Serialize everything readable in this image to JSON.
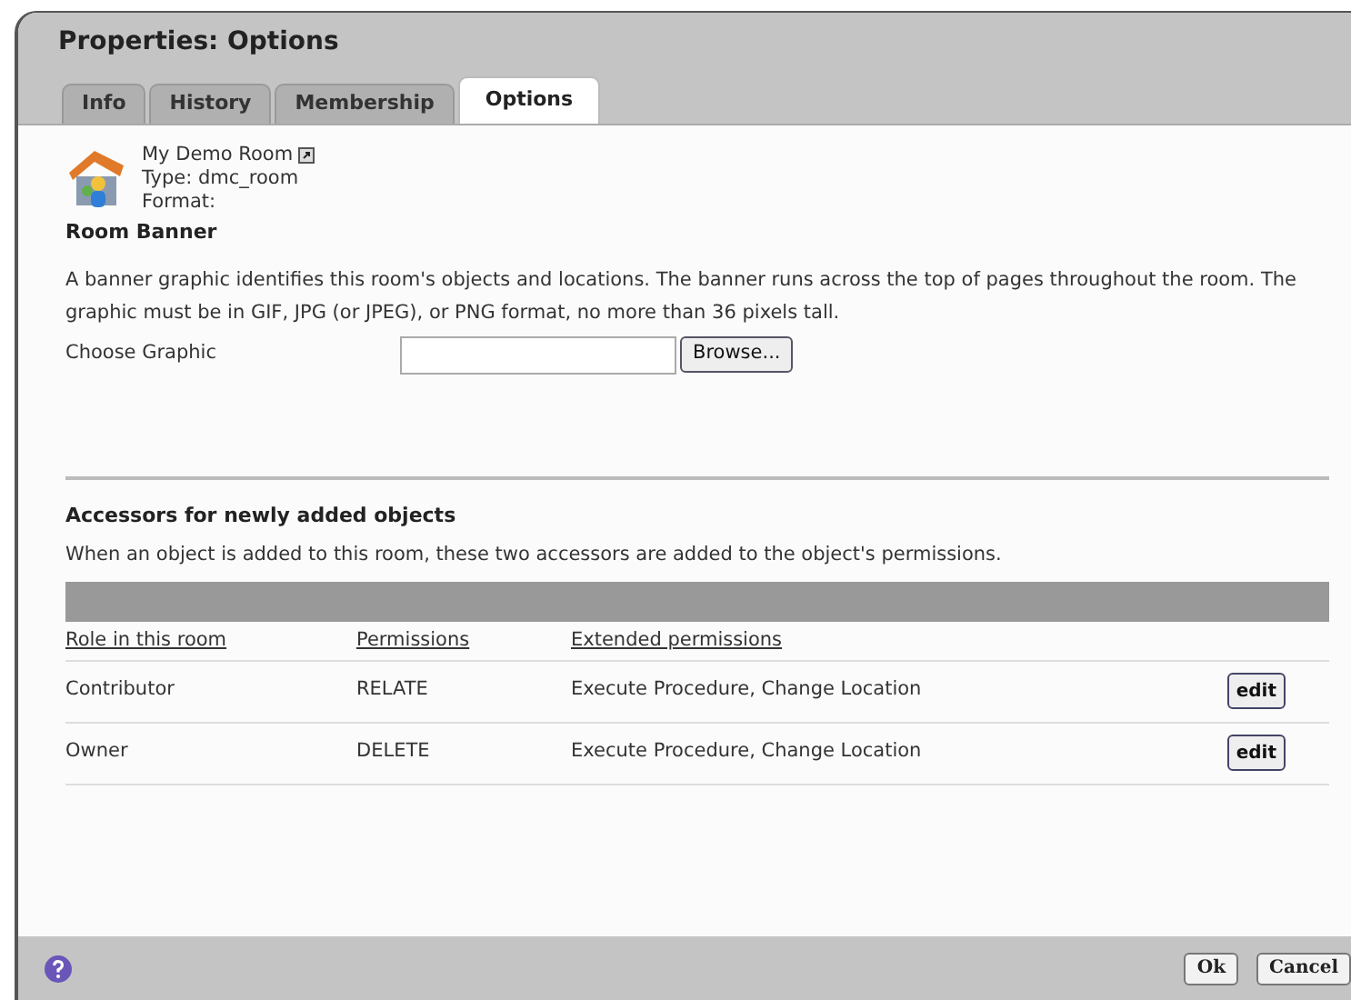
{
  "window": {
    "title": "Properties: Options"
  },
  "tabs": [
    {
      "label": "Info",
      "selected": false
    },
    {
      "label": "History",
      "selected": false
    },
    {
      "label": "Membership",
      "selected": false
    },
    {
      "label": "Options",
      "selected": true
    }
  ],
  "object": {
    "name": "My Demo Room",
    "type": "Type: dmc_room",
    "format": "Format:"
  },
  "room_banner": {
    "heading": "Room Banner",
    "description": "A banner graphic identifies this room's objects and locations. The banner runs across the top of pages throughout the room. The graphic must be in GIF, JPG (or JPEG), or PNG format, no more than 36 pixels tall.",
    "field_label": "Choose Graphic",
    "browse_button": "Browse..."
  },
  "accessors": {
    "heading": "Accessors for newly added objects",
    "description": "When an object is added to this room, these two accessors are added to the object's permissions.",
    "columns": [
      "Role in this room",
      "Permissions",
      "Extended permissions"
    ],
    "rows": [
      {
        "role": "Contributor",
        "permissions": "RELATE",
        "extended": "Execute Procedure, Change Location",
        "action": "edit"
      },
      {
        "role": "Owner",
        "permissions": "DELETE",
        "extended": "Execute Procedure, Change Location",
        "action": "edit"
      }
    ]
  },
  "footer": {
    "buttons": [
      "Ok",
      "Cancel"
    ]
  }
}
